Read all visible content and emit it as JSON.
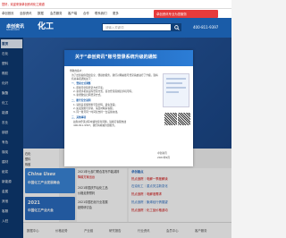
{
  "topbar": {
    "welcome": "您好，欢迎来到卓创资讯化工频道"
  },
  "navrow": {
    "items": [
      "卓创首页",
      "全部资讯",
      "数据",
      "会员服务",
      "客户端",
      "合作",
      "联系我们",
      "更多"
    ],
    "tooltip": "卓创资讯专业为您服务"
  },
  "header": {
    "logo_name": "卓创资讯",
    "logo_sub": "SCI99.COM",
    "site": "化工",
    "search_placeholder": "请输入关键词",
    "phone": "400-811-9397"
  },
  "leftmenu": [
    "首页",
    "石化",
    "塑料",
    "橡胶",
    "化纤",
    "聚酯",
    "化工",
    "能源",
    "农业",
    "钢铁",
    "有色",
    "煤炭",
    "建材",
    "纸浆",
    "新能源",
    "金属",
    "其他",
    "客服",
    "入驻"
  ],
  "modal": {
    "title": "关于“卓创资讯”账号登录系统升级的通知",
    "greeting": "尊敬的客户：",
    "p1": "为了给您提供更加安全、便捷的服务，我们对网站账号登录系统进行了升级，现将有关事项通知如下：",
    "sub1": "一、登录方式调整",
    "l1": "1. 原账号密码登录方式不变；",
    "l2": "2. 新增手机验证码登录方式，首次登录需绑定手机号码；",
    "l3": "3. 新增微信扫码登录方式。",
    "sub2": "二、账号安全说明",
    "l4": "1. 请您妥善保管账号及密码，避免泄露；",
    "l5": "2. 如发现账号异常，请及时联系客服；",
    "l6": "3. 同一账号同一时间仅支持一台设备在线。",
    "sub3": "三、其他事项",
    "l7": "如您在登录过程中遇到任何问题，请拨打客服热线",
    "l8": "400-811-9397，我们将竭诚为您服务。",
    "sign": "卓创资讯",
    "date": "2021年9月"
  },
  "content": {
    "promo1_a": "China Uses",
    "promo1_b": "中国化工产业发展峰会",
    "promo2_a": "2021",
    "promo2_b": "中国化工产业大会",
    "news": [
      {
        "text": "2021年七部门联合发布节能减排",
        "red": false
      },
      {
        "text": "降碳方案出台",
        "red": true
      },
      {
        "text": "2021年国庆节后化工品",
        "red": false
      },
      {
        "text": "价格走势预判",
        "red": false
      },
      {
        "text": "2021中国石化行业发展",
        "red": false
      },
      {
        "text": "趋势研讨会",
        "red": false
      }
    ],
    "right_title": "卓创看点",
    "right_items": [
      "热点追踪｜电解一季度解读",
      "石油化工｜重点关注新变化",
      "热点追踪｜电解液需求",
      "热点追踪｜聚烯烃行情展望",
      "热点追踪｜化工品价格波动"
    ],
    "lower_left": [
      "石化",
      "塑料",
      "橡胶"
    ],
    "bottom": [
      "数据中心",
      "价格走势",
      "产业链",
      "研究报告",
      "行业资讯",
      "会员中心",
      "客户服务"
    ]
  }
}
